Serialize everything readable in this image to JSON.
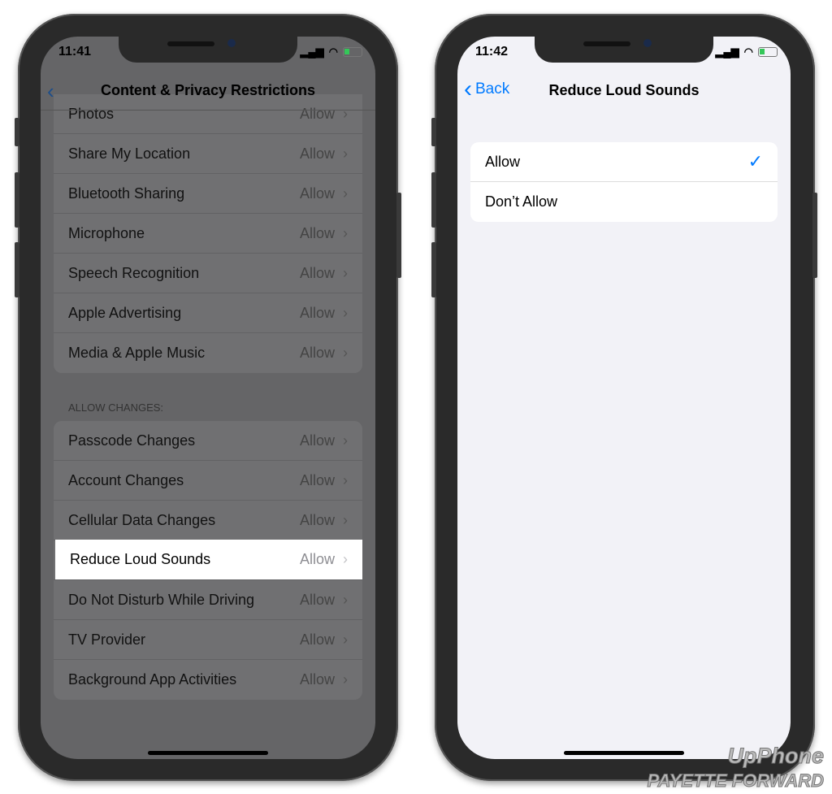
{
  "left": {
    "time": "11:41",
    "title": "Content & Privacy Restrictions",
    "group1": [
      {
        "label": "Photos",
        "value": "Allow"
      },
      {
        "label": "Share My Location",
        "value": "Allow"
      },
      {
        "label": "Bluetooth Sharing",
        "value": "Allow"
      },
      {
        "label": "Microphone",
        "value": "Allow"
      },
      {
        "label": "Speech Recognition",
        "value": "Allow"
      },
      {
        "label": "Apple Advertising",
        "value": "Allow"
      },
      {
        "label": "Media & Apple Music",
        "value": "Allow"
      }
    ],
    "section": "ALLOW CHANGES:",
    "group2": [
      {
        "label": "Passcode Changes",
        "value": "Allow"
      },
      {
        "label": "Account Changes",
        "value": "Allow"
      },
      {
        "label": "Cellular Data Changes",
        "value": "Allow"
      },
      {
        "label": "Reduce Loud Sounds",
        "value": "Allow"
      },
      {
        "label": "Do Not Disturb While Driving",
        "value": "Allow"
      },
      {
        "label": "TV Provider",
        "value": "Allow"
      },
      {
        "label": "Background App Activities",
        "value": "Allow"
      }
    ]
  },
  "right": {
    "time": "11:42",
    "back": "Back",
    "title": "Reduce Loud Sounds",
    "options": [
      {
        "label": "Allow",
        "selected": true
      },
      {
        "label": "Don’t Allow",
        "selected": false
      }
    ]
  },
  "watermark": {
    "line1": "UpPhone",
    "line2": "PAYETTE FORWARD"
  },
  "colors": {
    "accent": "#007aff"
  }
}
